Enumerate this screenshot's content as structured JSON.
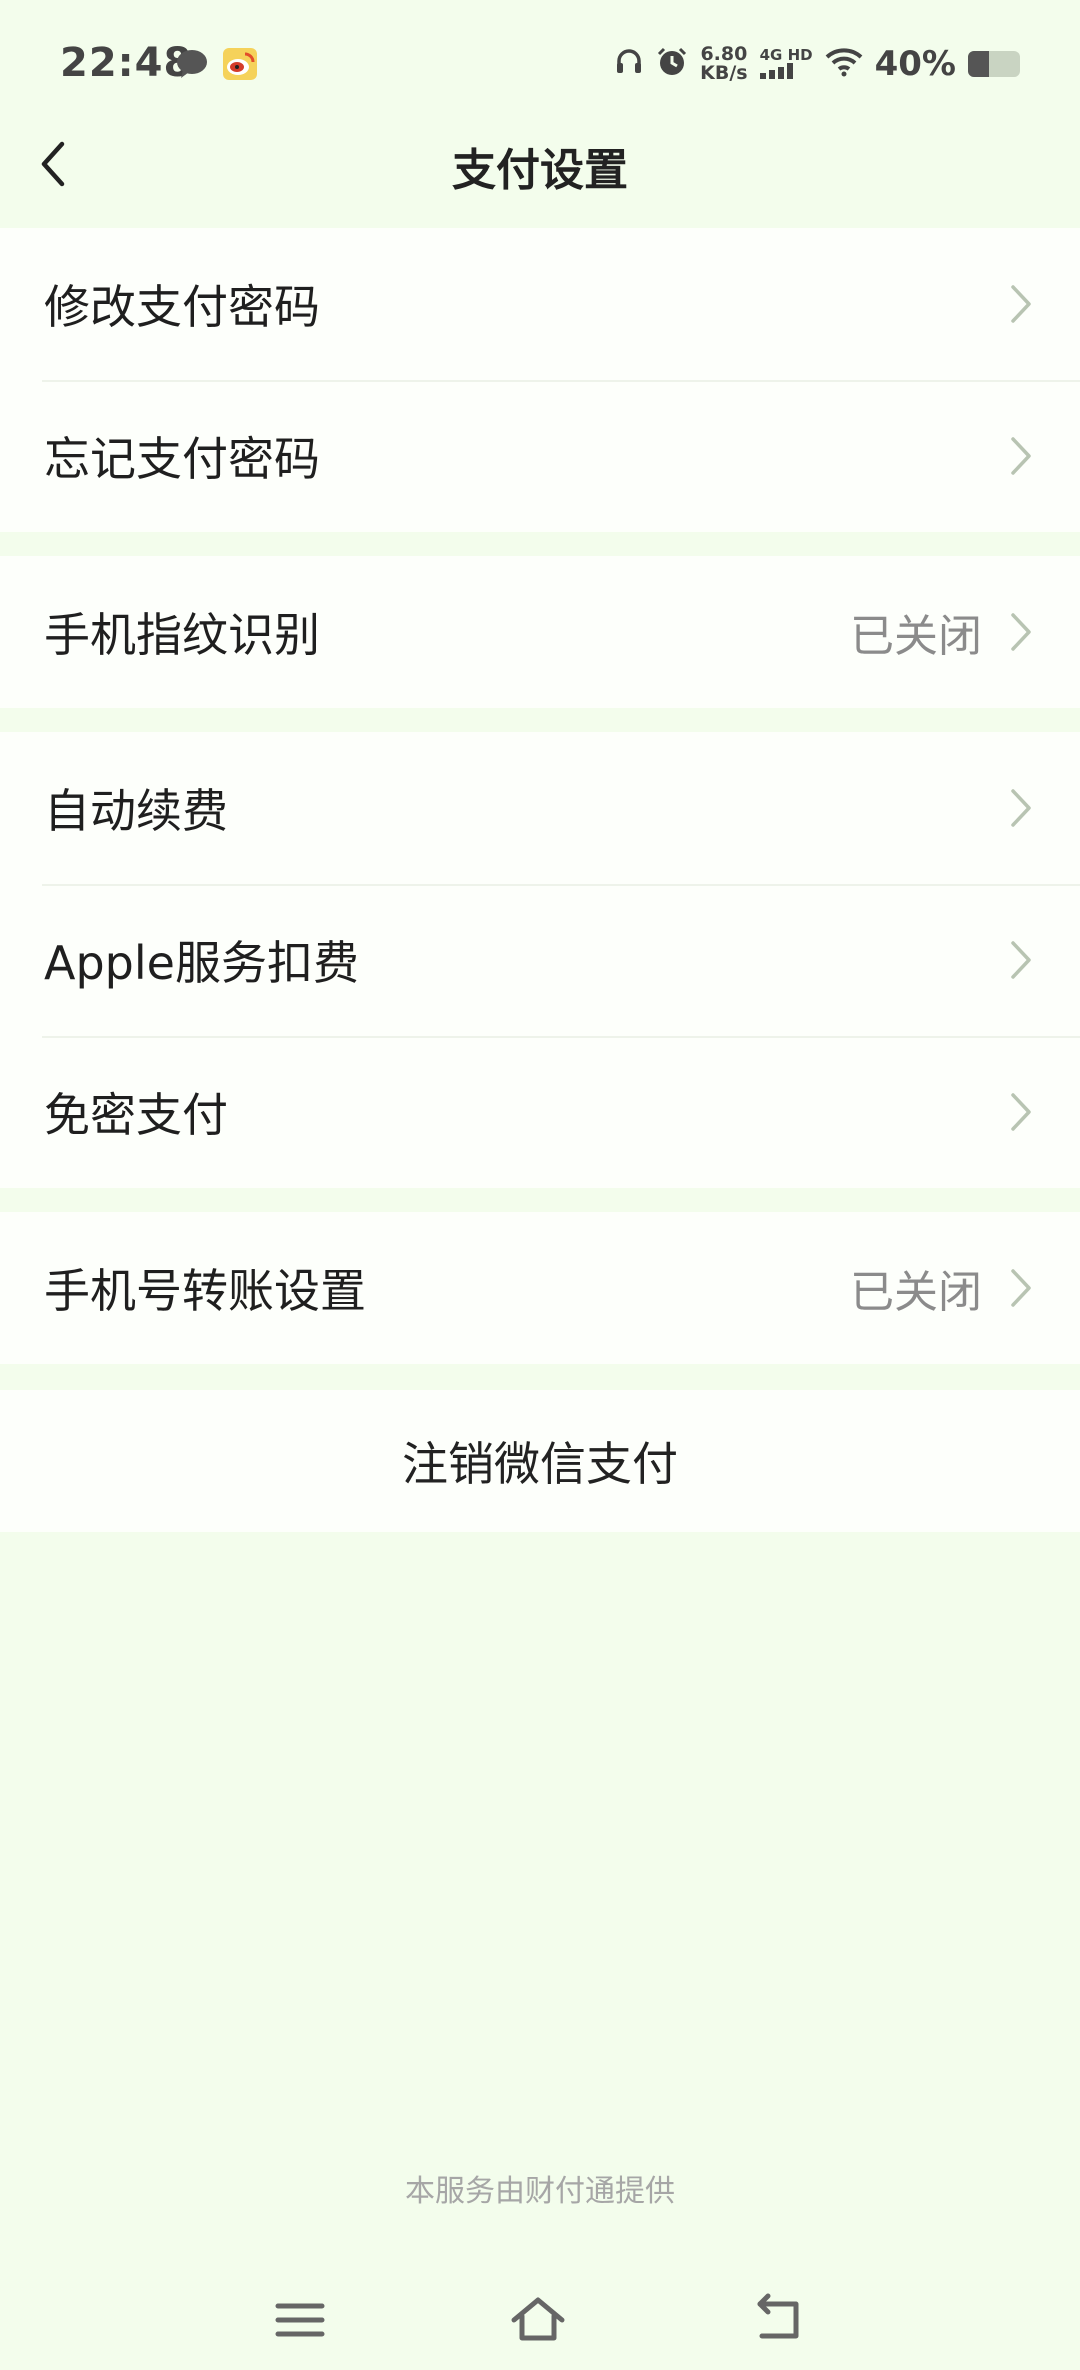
{
  "status_bar": {
    "time": "22:48",
    "net_speed_value": "6.80",
    "net_speed_unit": "KB/s",
    "net_type_top": "4G HD",
    "battery_pct": "40%",
    "battery_level": 0.4,
    "icons": [
      "message-icon",
      "weibo-icon",
      "headset-icon",
      "alarm-icon",
      "signal-icon",
      "wifi-icon",
      "battery-icon"
    ]
  },
  "navbar": {
    "title": "支付设置",
    "back_icon": "back-arrow-icon"
  },
  "groups": [
    {
      "items": [
        {
          "label": "修改支付密码",
          "value": ""
        },
        {
          "label": "忘记支付密码",
          "value": ""
        }
      ]
    },
    {
      "items": [
        {
          "label": "手机指纹识别",
          "value": "已关闭"
        }
      ]
    },
    {
      "items": [
        {
          "label": "自动续费",
          "value": ""
        },
        {
          "label": "Apple服务扣费",
          "value": ""
        },
        {
          "label": "免密支付",
          "value": ""
        }
      ]
    },
    {
      "items": [
        {
          "label": "手机号转账设置",
          "value": "已关闭"
        }
      ]
    }
  ],
  "logout": {
    "label": "注销微信支付"
  },
  "footer": {
    "text": "本服务由财付通提供"
  },
  "system_nav": {
    "icons": [
      "menu-icon",
      "home-icon",
      "back-icon"
    ]
  },
  "colors": {
    "background": "#f3fdec",
    "card": "#fdfffb",
    "chevron": "#b8c4b2",
    "muted_text": "#8b8b8b"
  }
}
